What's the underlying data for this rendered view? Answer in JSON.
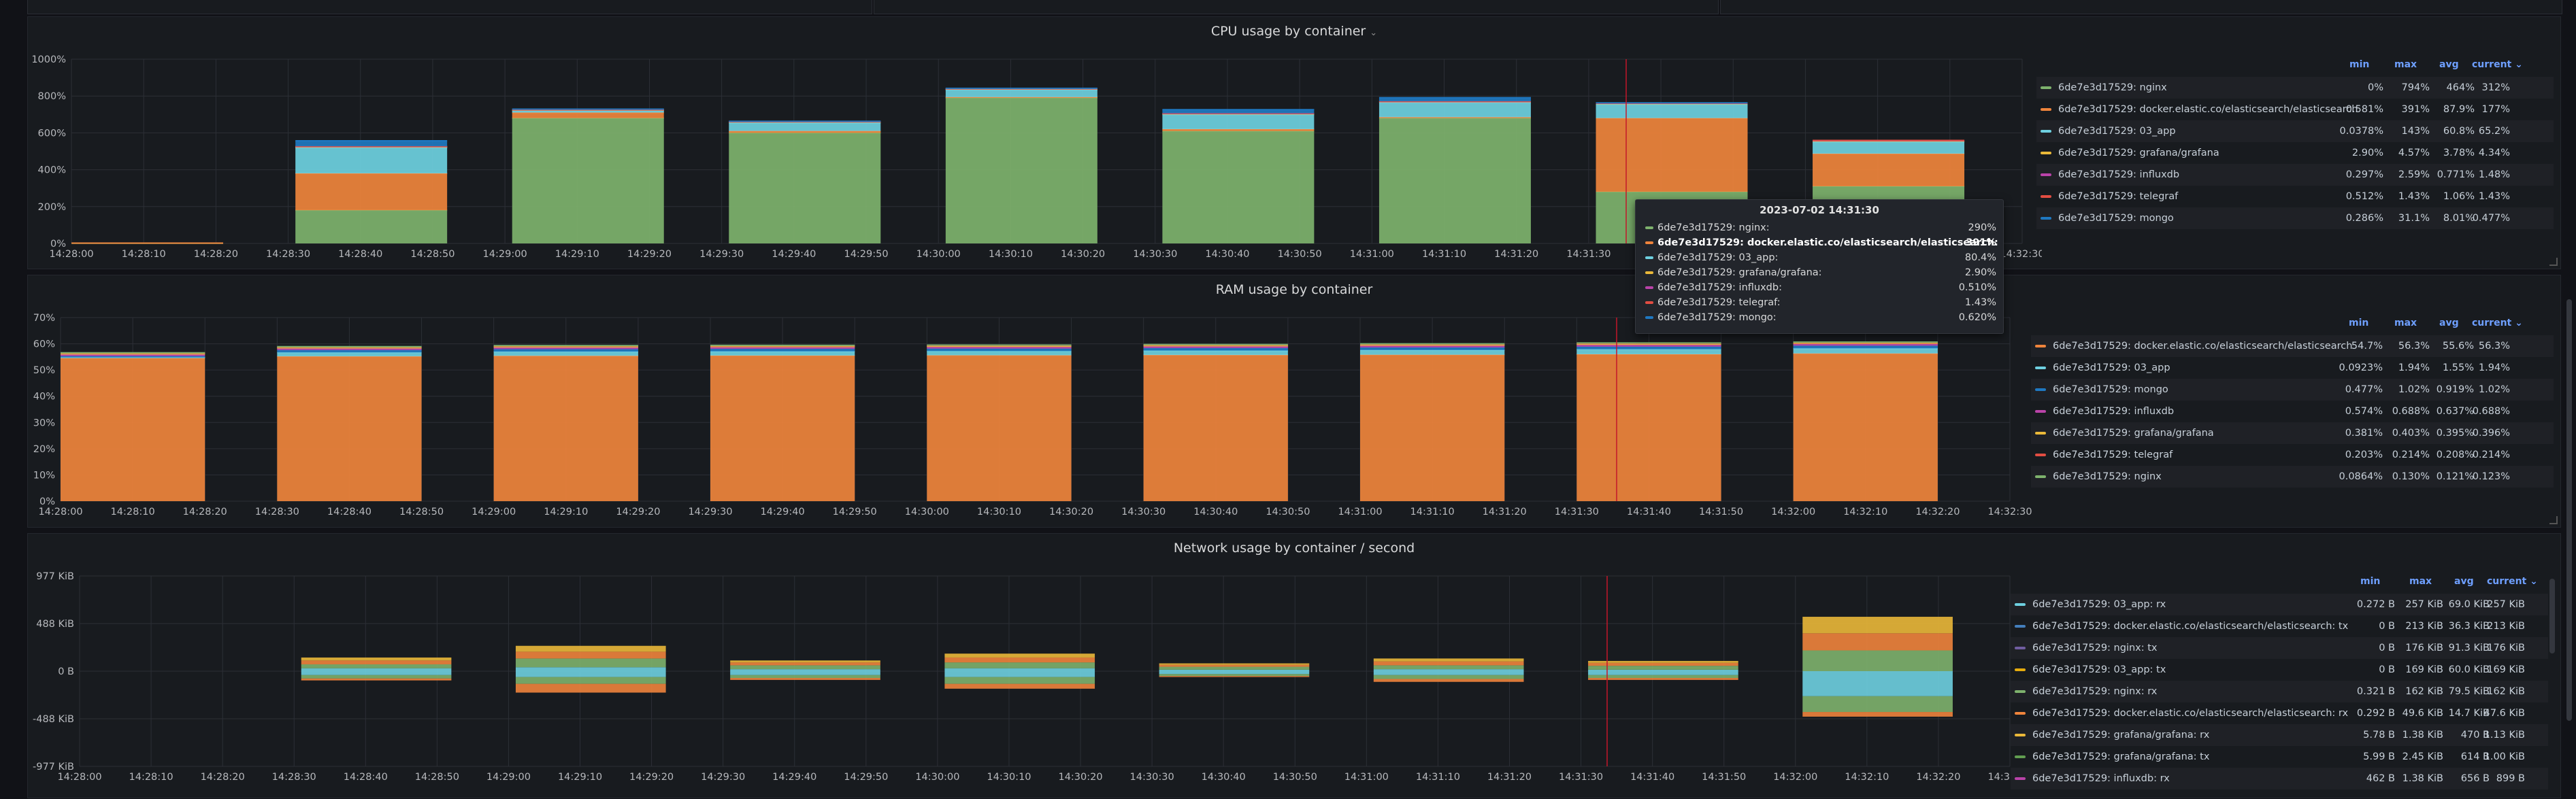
{
  "colors": {
    "green": "#7eb26d",
    "orange": "#ef843c",
    "cyan": "#6ed0e0",
    "yellow": "#eab839",
    "purple": "#ba43a9",
    "red": "#e24d42",
    "blue": "#1f78c1",
    "slate": "#508642",
    "lightblue": "#70dbed",
    "violet": "#705da0",
    "gold": "#e5ac0e",
    "lime": "#629e51",
    "navy": "#447ebc",
    "khaki": "#bf9a3e"
  },
  "cpu": {
    "title": "CPU usage by container",
    "chevron": "⌄",
    "yticks": [
      "0%",
      "200%",
      "400%",
      "600%",
      "800%",
      "1000%"
    ],
    "xticks": [
      "14:28:00",
      "14:28:10",
      "14:28:20",
      "14:28:30",
      "14:28:40",
      "14:28:50",
      "14:29:00",
      "14:29:10",
      "14:29:20",
      "14:29:30",
      "14:29:40",
      "14:29:50",
      "14:30:00",
      "14:30:10",
      "14:30:20",
      "14:30:30",
      "14:30:40",
      "14:30:50",
      "14:31:00",
      "14:31:10",
      "14:31:20",
      "14:31:30",
      "14:31:40",
      "14:31:50",
      "14:32:00",
      "14:32:10",
      "14:32:20",
      "14:32:30"
    ],
    "legend_headers": {
      "min": "min",
      "max": "max",
      "avg": "avg",
      "current": "current ⌄"
    },
    "legend": [
      {
        "color": "#7eb26d",
        "name": "6de7e3d17529: nginx",
        "min": "0%",
        "max": "794%",
        "avg": "464%",
        "current": "312%"
      },
      {
        "color": "#ef843c",
        "name": "6de7e3d17529: docker.elastic.co/elasticsearch/elasticsearch",
        "min": "0.581%",
        "max": "391%",
        "avg": "87.9%",
        "current": "177%"
      },
      {
        "color": "#6ed0e0",
        "name": "6de7e3d17529: 03_app",
        "min": "0.0378%",
        "max": "143%",
        "avg": "60.8%",
        "current": "65.2%"
      },
      {
        "color": "#eab839",
        "name": "6de7e3d17529: grafana/grafana",
        "min": "2.90%",
        "max": "4.57%",
        "avg": "3.78%",
        "current": "4.34%"
      },
      {
        "color": "#ba43a9",
        "name": "6de7e3d17529: influxdb",
        "min": "0.297%",
        "max": "2.59%",
        "avg": "0.771%",
        "current": "1.48%"
      },
      {
        "color": "#e24d42",
        "name": "6de7e3d17529: telegraf",
        "min": "0.512%",
        "max": "1.43%",
        "avg": "1.06%",
        "current": "1.43%"
      },
      {
        "color": "#1f78c1",
        "name": "6de7e3d17529: mongo",
        "min": "0.286%",
        "max": "31.1%",
        "avg": "8.01%",
        "current": "0.477%"
      }
    ],
    "chart_data": {
      "type": "area",
      "ylim": [
        0,
        1000
      ],
      "bars": [
        {
          "x0": 0,
          "x1": 21,
          "vals": [
            1,
            1,
            0.5,
            0.5,
            0,
            0,
            0
          ]
        },
        {
          "x0": 31,
          "x1": 52,
          "vals": [
            180,
            200,
            140,
            4,
            2,
            1,
            30
          ]
        },
        {
          "x0": 61,
          "x1": 82,
          "vals": [
            680,
            30,
            10,
            4,
            1,
            1,
            3
          ]
        },
        {
          "x0": 91,
          "x1": 112,
          "vals": [
            600,
            10,
            45,
            4,
            1,
            1,
            2
          ]
        },
        {
          "x0": 121,
          "x1": 142,
          "vals": [
            790,
            4,
            40,
            4,
            1,
            1,
            2
          ]
        },
        {
          "x0": 151,
          "x1": 172,
          "vals": [
            610,
            10,
            80,
            4,
            1,
            1,
            20
          ]
        },
        {
          "x0": 181,
          "x1": 202,
          "vals": [
            680,
            5,
            80,
            4,
            1,
            1,
            20
          ]
        },
        {
          "x0": 211,
          "x1": 232,
          "vals": [
            280,
            400,
            75,
            4,
            1,
            1,
            2
          ]
        },
        {
          "x0": 241,
          "x1": 262,
          "vals": [
            310,
            177,
            65,
            4,
            1.5,
            1.4,
            0.5
          ]
        }
      ]
    }
  },
  "ram": {
    "title": "RAM usage by container",
    "yticks": [
      "0%",
      "10%",
      "20%",
      "30%",
      "40%",
      "50%",
      "60%",
      "70%"
    ],
    "xticks": [
      "14:28:00",
      "14:28:10",
      "14:28:20",
      "14:28:30",
      "14:28:40",
      "14:28:50",
      "14:29:00",
      "14:29:10",
      "14:29:20",
      "14:29:30",
      "14:29:40",
      "14:29:50",
      "14:30:00",
      "14:30:10",
      "14:30:20",
      "14:30:30",
      "14:30:40",
      "14:30:50",
      "14:31:00",
      "14:31:10",
      "14:31:20",
      "14:31:30",
      "14:31:40",
      "14:31:50",
      "14:32:00",
      "14:32:10",
      "14:32:20",
      "14:32:30"
    ],
    "legend_headers": {
      "min": "min",
      "max": "max",
      "avg": "avg",
      "current": "current ⌄"
    },
    "legend": [
      {
        "color": "#ef843c",
        "name": "6de7e3d17529: docker.elastic.co/elasticsearch/elasticsearch",
        "min": "54.7%",
        "max": "56.3%",
        "avg": "55.6%",
        "current": "56.3%"
      },
      {
        "color": "#6ed0e0",
        "name": "6de7e3d17529: 03_app",
        "min": "0.0923%",
        "max": "1.94%",
        "avg": "1.55%",
        "current": "1.94%"
      },
      {
        "color": "#1f78c1",
        "name": "6de7e3d17529: mongo",
        "min": "0.477%",
        "max": "1.02%",
        "avg": "0.919%",
        "current": "1.02%"
      },
      {
        "color": "#ba43a9",
        "name": "6de7e3d17529: influxdb",
        "min": "0.574%",
        "max": "0.688%",
        "avg": "0.637%",
        "current": "0.688%"
      },
      {
        "color": "#eab839",
        "name": "6de7e3d17529: grafana/grafana",
        "min": "0.381%",
        "max": "0.403%",
        "avg": "0.395%",
        "current": "0.396%"
      },
      {
        "color": "#e24d42",
        "name": "6de7e3d17529: telegraf",
        "min": "0.203%",
        "max": "0.214%",
        "avg": "0.208%",
        "current": "0.214%"
      },
      {
        "color": "#7eb26d",
        "name": "6de7e3d17529: nginx",
        "min": "0.0864%",
        "max": "0.130%",
        "avg": "0.121%",
        "current": "0.123%"
      }
    ],
    "chart_data": {
      "type": "area",
      "ylim": [
        0,
        70
      ],
      "bars": [
        {
          "x0": 0,
          "x1": 20,
          "vals": [
            54.7,
            0.1,
            0.5,
            0.6,
            0.4,
            0.2,
            0.09
          ]
        },
        {
          "x0": 30,
          "x1": 50,
          "vals": [
            55.2,
            1.5,
            0.9,
            0.6,
            0.4,
            0.2,
            0.12
          ]
        },
        {
          "x0": 60,
          "x1": 80,
          "vals": [
            55.4,
            1.6,
            0.95,
            0.63,
            0.4,
            0.2,
            0.12
          ]
        },
        {
          "x0": 90,
          "x1": 110,
          "vals": [
            55.5,
            1.6,
            0.95,
            0.63,
            0.4,
            0.2,
            0.12
          ]
        },
        {
          "x0": 120,
          "x1": 140,
          "vals": [
            55.6,
            1.6,
            0.95,
            0.64,
            0.4,
            0.2,
            0.12
          ]
        },
        {
          "x0": 150,
          "x1": 170,
          "vals": [
            55.7,
            1.7,
            0.95,
            0.65,
            0.4,
            0.2,
            0.12
          ]
        },
        {
          "x0": 180,
          "x1": 200,
          "vals": [
            55.8,
            1.8,
            1.0,
            0.66,
            0.4,
            0.21,
            0.12
          ]
        },
        {
          "x0": 210,
          "x1": 230,
          "vals": [
            56.0,
            1.9,
            1.0,
            0.68,
            0.4,
            0.21,
            0.12
          ]
        },
        {
          "x0": 240,
          "x1": 260,
          "vals": [
            56.3,
            1.94,
            1.02,
            0.688,
            0.396,
            0.214,
            0.123
          ]
        }
      ]
    }
  },
  "net": {
    "title": "Network usage by container / second",
    "yticks": [
      "-977 KiB",
      "-488 KiB",
      "0 B",
      "488 KiB",
      "977 KiB"
    ],
    "xticks": [
      "14:28:00",
      "14:28:10",
      "14:28:20",
      "14:28:30",
      "14:28:40",
      "14:28:50",
      "14:29:00",
      "14:29:10",
      "14:29:20",
      "14:29:30",
      "14:29:40",
      "14:29:50",
      "14:30:00",
      "14:30:10",
      "14:30:20",
      "14:30:30",
      "14:30:40",
      "14:30:50",
      "14:31:00",
      "14:31:10",
      "14:31:20",
      "14:31:30",
      "14:31:40",
      "14:31:50",
      "14:32:00",
      "14:32:10",
      "14:32:20",
      "14:32:30"
    ],
    "legend_headers": {
      "min": "min",
      "max": "max",
      "avg": "avg",
      "current": "current ⌄"
    },
    "legend": [
      {
        "color": "#6ed0e0",
        "name": "6de7e3d17529: 03_app: rx",
        "min": "0.272 B",
        "max": "257 KiB",
        "avg": "69.0 KiB",
        "current": "257 KiB"
      },
      {
        "color": "#447ebc",
        "name": "6de7e3d17529: docker.elastic.co/elasticsearch/elasticsearch: tx",
        "min": "0 B",
        "max": "213 KiB",
        "avg": "36.3 KiB",
        "current": "213 KiB"
      },
      {
        "color": "#705da0",
        "name": "6de7e3d17529: nginx: tx",
        "min": "0 B",
        "max": "176 KiB",
        "avg": "91.3 KiB",
        "current": "176 KiB"
      },
      {
        "color": "#e5ac0e",
        "name": "6de7e3d17529: 03_app: tx",
        "min": "0 B",
        "max": "169 KiB",
        "avg": "60.0 KiB",
        "current": "169 KiB"
      },
      {
        "color": "#7eb26d",
        "name": "6de7e3d17529: nginx: rx",
        "min": "0.321 B",
        "max": "162 KiB",
        "avg": "79.5 KiB",
        "current": "162 KiB"
      },
      {
        "color": "#ef843c",
        "name": "6de7e3d17529: docker.elastic.co/elasticsearch/elasticsearch: rx",
        "min": "0.292 B",
        "max": "49.6 KiB",
        "avg": "14.7 KiB",
        "current": "47.6 KiB"
      },
      {
        "color": "#eab839",
        "name": "6de7e3d17529: grafana/grafana: rx",
        "min": "5.78 B",
        "max": "1.38 KiB",
        "avg": "470 B",
        "current": "1.13 KiB"
      },
      {
        "color": "#629e51",
        "name": "6de7e3d17529: grafana/grafana: tx",
        "min": "5.99 B",
        "max": "2.45 KiB",
        "avg": "614 B",
        "current": "1.00 KiB"
      },
      {
        "color": "#ba43a9",
        "name": "6de7e3d17529: influxdb: rx",
        "min": "462 B",
        "max": "1.38 KiB",
        "avg": "656 B",
        "current": "899 B"
      }
    ],
    "chart_data": {
      "type": "area",
      "ylim": [
        -977,
        977
      ],
      "bars": [
        {
          "x0": 31,
          "x1": 52,
          "pos": [
            30,
            40,
            40,
            30
          ],
          "neg": [
            40,
            35,
            20
          ]
        },
        {
          "x0": 61,
          "x1": 82,
          "pos": [
            40,
            90,
            70,
            60
          ],
          "neg": [
            60,
            70,
            90
          ]
        },
        {
          "x0": 91,
          "x1": 112,
          "pos": [
            20,
            40,
            30,
            20
          ],
          "neg": [
            40,
            30,
            20
          ]
        },
        {
          "x0": 121,
          "x1": 142,
          "pos": [
            30,
            60,
            50,
            40
          ],
          "neg": [
            60,
            70,
            50
          ]
        },
        {
          "x0": 151,
          "x1": 172,
          "pos": [
            15,
            30,
            20,
            15
          ],
          "neg": [
            30,
            20,
            10
          ]
        },
        {
          "x0": 181,
          "x1": 202,
          "pos": [
            20,
            40,
            40,
            30
          ],
          "neg": [
            40,
            40,
            30
          ]
        },
        {
          "x0": 211,
          "x1": 232,
          "pos": [
            15,
            40,
            30,
            20
          ],
          "neg": [
            40,
            30,
            20
          ]
        },
        {
          "x0": 241,
          "x1": 262,
          "pos": [
            0,
            213,
            176,
            169
          ],
          "neg": [
            257,
            162,
            48
          ]
        }
      ]
    }
  },
  "tooltip": {
    "title": "2023-07-02 14:31:30",
    "rows": [
      {
        "color": "#7eb26d",
        "name": "6de7e3d17529: nginx:",
        "value": "290%",
        "bold": false
      },
      {
        "color": "#ef843c",
        "name": "6de7e3d17529: docker.elastic.co/elasticsearch/elasticsearch:",
        "value": "391%",
        "bold": true
      },
      {
        "color": "#6ed0e0",
        "name": "6de7e3d17529: 03_app:",
        "value": "80.4%",
        "bold": false
      },
      {
        "color": "#eab839",
        "name": "6de7e3d17529: grafana/grafana:",
        "value": "2.90%",
        "bold": false
      },
      {
        "color": "#ba43a9",
        "name": "6de7e3d17529: influxdb:",
        "value": "0.510%",
        "bold": false
      },
      {
        "color": "#e24d42",
        "name": "6de7e3d17529: telegraf:",
        "value": "1.43%",
        "bold": false
      },
      {
        "color": "#1f78c1",
        "name": "6de7e3d17529: mongo:",
        "value": "0.620%",
        "bold": false
      }
    ]
  }
}
